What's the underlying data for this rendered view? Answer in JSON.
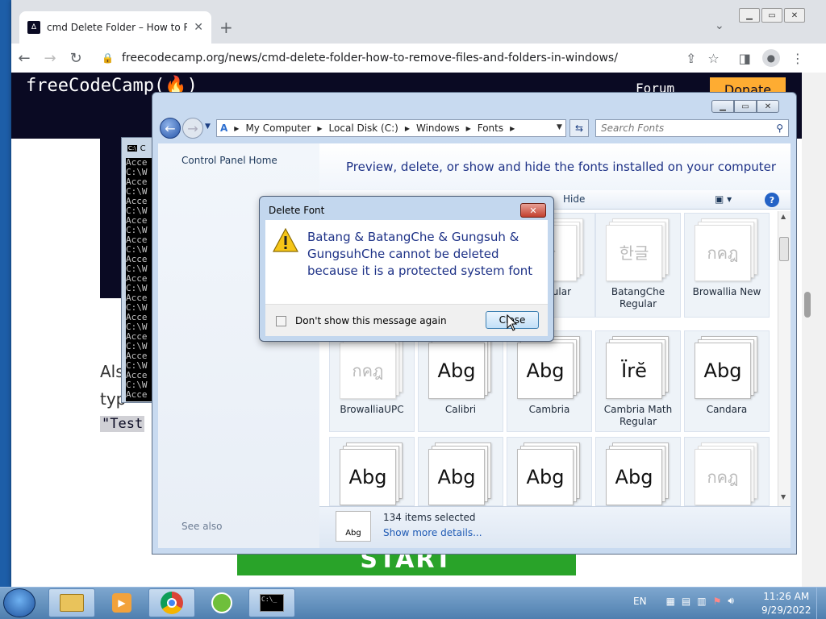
{
  "browser": {
    "tab_title": "cmd Delete Folder – How to Rem",
    "tab_favicon": "freecodecamp-icon",
    "url": "freecodecamp.org/news/cmd-delete-folder-how-to-remove-files-and-folders-in-windows/"
  },
  "page": {
    "logo": "freeCodeCamp(🔥)",
    "forum": "Forum",
    "donate": "Donate",
    "text_line1": "Als",
    "text_line2": "typ",
    "code": "\"Test",
    "start_button": "START"
  },
  "cmd": {
    "title": "C",
    "lines": "Acce\nC:\\W\nAcce\nC:\\W\nAcce\nC:\\W\nAcce\nC:\\W\nAcce\nC:\\W\nAcce\nC:\\W\nAcce\nC:\\W\nAcce\nC:\\W\nAcce\nC:\\W\nAcce\nC:\\W\nAcce\nC:\\W\nAcce\nC:\\W\nAcce\n\nC:\\W"
  },
  "explorer": {
    "breadcrumb": [
      "My Computer",
      "Local Disk (C:)",
      "Windows",
      "Fonts"
    ],
    "search_placeholder": "Search Fonts",
    "left_pane": {
      "home": "Control Panel Home",
      "see_also": "See also"
    },
    "header_text": "Preview, delete, or show and hide the fonts installed on your computer",
    "cmdbar_hide": "Hide",
    "tiles": [
      {
        "name": "Regular",
        "glyph": "글",
        "ghost": true,
        "selected": true
      },
      {
        "name": "BatangChe Regular",
        "glyph": "한글",
        "ghost": true,
        "selected": true
      },
      {
        "name": "Browallia New",
        "glyph": "กคฎ",
        "ghost": true,
        "selected": true
      },
      {
        "name": "BrowalliaUPC",
        "glyph": "กคฎ",
        "ghost": true,
        "selected": true
      },
      {
        "name": "Calibri",
        "glyph": "Abg",
        "ghost": false,
        "selected": true
      },
      {
        "name": "Cambria",
        "glyph": "Abg",
        "ghost": false,
        "selected": true
      },
      {
        "name": "Cambria Math Regular",
        "glyph": "Ïrĕ",
        "ghost": false,
        "selected": true
      },
      {
        "name": "Candara",
        "glyph": "Abg",
        "ghost": false,
        "selected": true
      },
      {
        "name": "",
        "glyph": "Abg",
        "ghost": false,
        "selected": true
      },
      {
        "name": "",
        "glyph": "Abg",
        "ghost": false,
        "selected": true
      },
      {
        "name": "",
        "glyph": "Abg",
        "ghost": false,
        "selected": true
      },
      {
        "name": "",
        "glyph": "Abg",
        "ghost": false,
        "selected": true
      },
      {
        "name": "",
        "glyph": "กคฎ",
        "ghost": true,
        "selected": true
      }
    ],
    "status_count": "134 items selected",
    "status_link": "Show more details...",
    "status_icon_label": "Abg"
  },
  "dialog": {
    "title": "Delete Font",
    "message": "Batang & BatangChe & Gungsuh & GungsuhChe cannot be deleted because it is a protected system font",
    "checkbox_label": "Don't show this message again",
    "close_button": "Close",
    "icon": "warning-icon"
  },
  "taskbar": {
    "lang": "EN",
    "time": "11:26 AM",
    "date": "9/29/2022"
  },
  "colors": {
    "fcc_navy": "#0a0a23",
    "donate_orange": "#feac32",
    "start_green": "#29a329",
    "explorer_header_blue": "#1e3287"
  }
}
